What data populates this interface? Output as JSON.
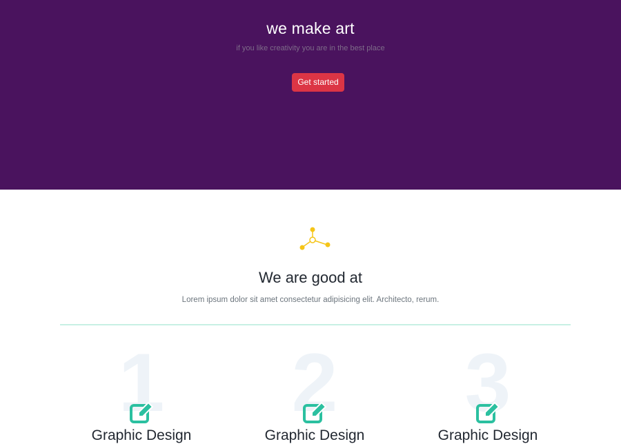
{
  "hero": {
    "title": "we make art",
    "subtitle": "if you like creativity you are in the best place",
    "cta_label": "Get started",
    "background": "#4a135e",
    "cta_color": "#dc3545"
  },
  "services": {
    "icon": "molecule-icon",
    "icon_color": "#f5c518",
    "title": "We are good at",
    "description": "Lorem ipsum dolor sit amet consectetur adipisicing elit. Architecto, rerum.",
    "divider_color": "#c7f0e4",
    "cards": [
      {
        "number": "1",
        "icon": "edit-icon",
        "title": "Graphic Design"
      },
      {
        "number": "2",
        "icon": "edit-icon",
        "title": "Graphic Design"
      },
      {
        "number": "3",
        "icon": "edit-icon",
        "title": "Graphic Design"
      }
    ],
    "card_icon_color": "#2bc0a0"
  }
}
